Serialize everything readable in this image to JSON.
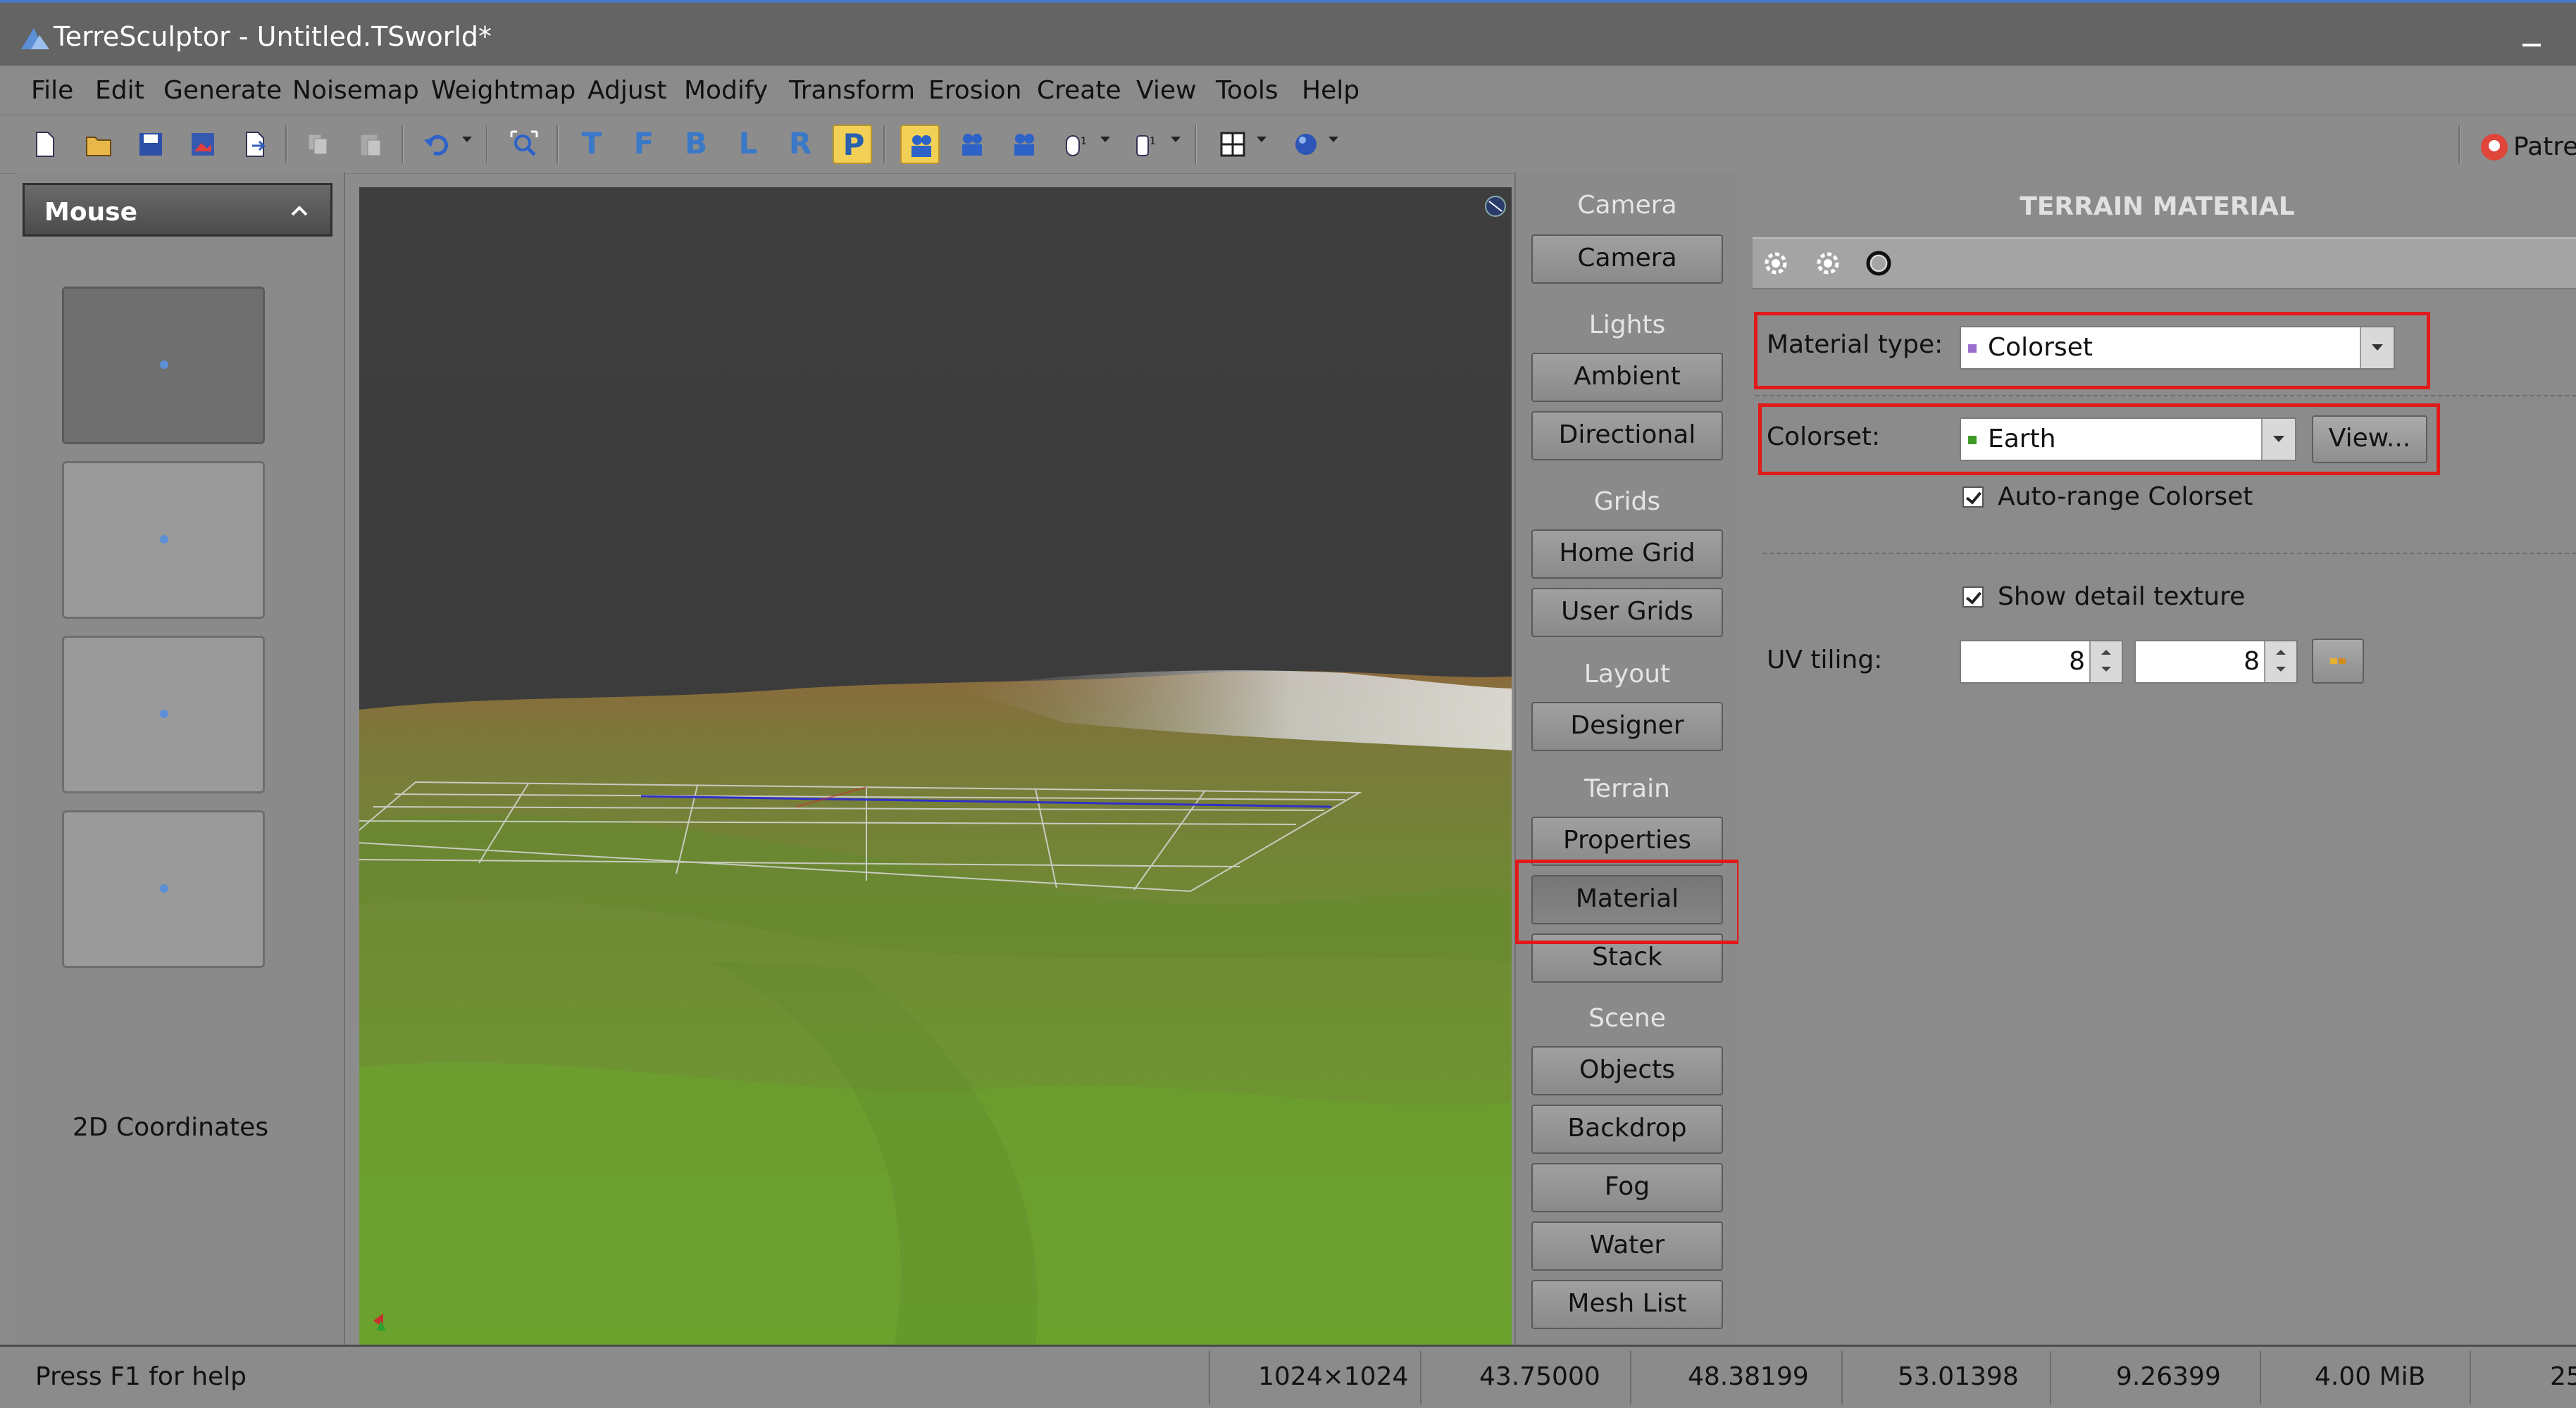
{
  "window": {
    "title": "TerreSculptor - Untitled.TSworld*"
  },
  "menu": [
    "File",
    "Edit",
    "Generate",
    "Noisemap",
    "Weightmap",
    "Adjust",
    "Modify",
    "Transform",
    "Erosion",
    "Create",
    "View",
    "Tools",
    "Help"
  ],
  "toolbar": {
    "view_letters": [
      "T",
      "F",
      "B",
      "L",
      "R",
      "P"
    ],
    "active_view": "P",
    "patreon_label": "Patre"
  },
  "left_panel": {
    "header": "Mouse",
    "coords_label": "2D Coordinates"
  },
  "side_column": {
    "groups": [
      {
        "heading": "Camera",
        "buttons": [
          "Camera"
        ]
      },
      {
        "heading": "Lights",
        "buttons": [
          "Ambient",
          "Directional"
        ]
      },
      {
        "heading": "Grids",
        "buttons": [
          "Home Grid",
          "User Grids"
        ]
      },
      {
        "heading": "Layout",
        "buttons": [
          "Designer"
        ]
      },
      {
        "heading": "Terrain",
        "buttons": [
          "Properties",
          "Material",
          "Stack"
        ]
      },
      {
        "heading": "Scene",
        "buttons": [
          "Objects",
          "Backdrop",
          "Fog",
          "Water",
          "Mesh List"
        ]
      }
    ],
    "selected": "Material"
  },
  "terrain_material": {
    "title": "TERRAIN MATERIAL",
    "material_type_label": "Material type:",
    "material_type_value": "Colorset",
    "colorset_label": "Colorset:",
    "colorset_value": "Earth",
    "view_button": "View...",
    "auto_range_label": "Auto-range Colorset",
    "auto_range_checked": true,
    "show_detail_label": "Show detail texture",
    "show_detail_checked": true,
    "uv_tiling_label": "UV tiling:",
    "uv_tiling_u": "8",
    "uv_tiling_v": "8"
  },
  "status": {
    "help": "Press F1 for help",
    "cells": [
      "1024×1024",
      "43.75000",
      "48.38199",
      "53.01398",
      "9.26399",
      "4.00 MiB",
      "25"
    ]
  },
  "colors": {
    "highlight_box": "#e01a1a",
    "active_tool": "#f2d055",
    "terrain_green": "#6d9a32",
    "terrain_brown": "#8b6a3c"
  }
}
